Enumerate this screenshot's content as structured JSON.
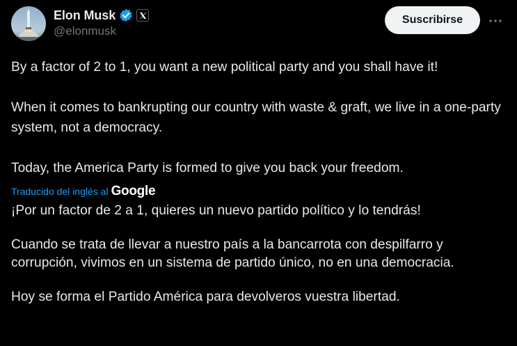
{
  "author": {
    "display_name": "Elon Musk",
    "handle": "@elonmusk",
    "avatar_icon": "rocket-launch-avatar",
    "verified_icon": "verified-badge-icon",
    "affiliation_icon": "x-logo-icon"
  },
  "actions": {
    "subscribe_label": "Suscribirse",
    "more_icon": "more-options-icon"
  },
  "tweet": {
    "paragraphs": [
      "By a factor of 2 to 1, you want a new political party and you shall have it!",
      "When it comes to bankrupting our country with waste & graft, we live in a one-party system, not a democracy.",
      "Today, the America Party is formed to give you back your freedom."
    ]
  },
  "translation": {
    "label": "Traducido del inglés al",
    "provider": "Google",
    "paragraphs": [
      "¡Por un factor de 2 a 1, quieres un nuevo partido político y lo tendrás!",
      "Cuando se trata de llevar a nuestro país a la bancarrota con despilfarro y corrupción, vivimos en un sistema de partido único, no en una democracia.",
      "Hoy se forma el Partido América para devolveros vuestra libertad."
    ]
  },
  "colors": {
    "background": "#000000",
    "text_primary": "#e7e9ea",
    "text_secondary": "#71767b",
    "link_blue": "#1d9bf0",
    "verified_blue": "#1d9bf0",
    "button_bg": "#eff3f4"
  }
}
